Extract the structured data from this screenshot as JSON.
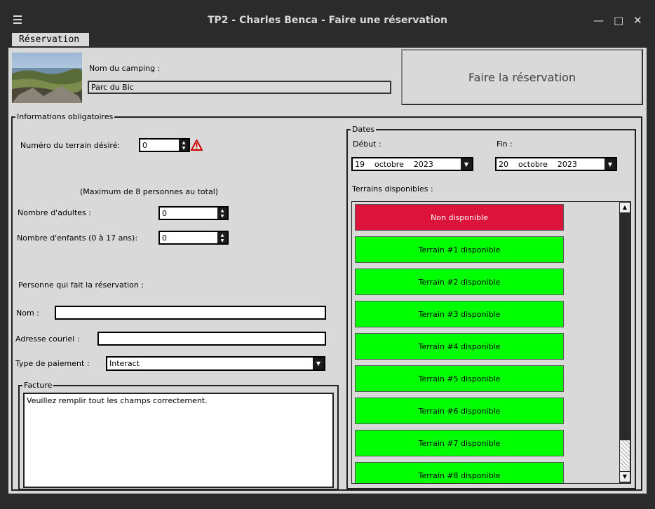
{
  "window": {
    "title": "TP2 - Charles Benca - Faire une réservation",
    "minimize": "—",
    "maximize": "□",
    "close": "✕"
  },
  "menu": {
    "reservation": "Réservation"
  },
  "camping": {
    "label": "Nom du camping :",
    "value": "Parc du Bic"
  },
  "submit_button": "Faire la réservation",
  "info": {
    "legend": "Informations obligatoires",
    "terrain_label": "Numéro du terrain désiré:",
    "terrain_value": "0",
    "max_note": "(Maximum de 8 personnes au total)",
    "adults_label": "Nombre d'adultes :",
    "adults_value": "0",
    "children_label": "Nombre d'enfants (0 à 17 ans):",
    "children_value": "0",
    "person_heading": "Personne qui fait la réservation :",
    "name_label": "Nom :",
    "name_value": "",
    "email_label": "Adresse couriel :",
    "email_value": "",
    "payment_label": "Type de paiement :",
    "payment_value": "Interact"
  },
  "invoice": {
    "legend": "Facture",
    "text": "Veuillez remplir tout les champs correctement."
  },
  "dates": {
    "legend": "Dates",
    "start_label": "Début :",
    "start": {
      "day": "19",
      "month": "octobre",
      "year": "2023"
    },
    "end_label": "Fin :",
    "end": {
      "day": "20",
      "month": "octobre",
      "year": "2023"
    },
    "available_label": "Terrains disponibles :"
  },
  "terrains": [
    {
      "label": "Non disponible",
      "status": "unavailable"
    },
    {
      "label": "Terrain #1 disponible",
      "status": "available"
    },
    {
      "label": "Terrain #2 disponible",
      "status": "available"
    },
    {
      "label": "Terrain #3 disponible",
      "status": "available"
    },
    {
      "label": "Terrain #4 disponible",
      "status": "available"
    },
    {
      "label": "Terrain #5 disponible",
      "status": "available"
    },
    {
      "label": "Terrain #6 disponible",
      "status": "available"
    },
    {
      "label": "Terrain #7 disponible",
      "status": "available"
    },
    {
      "label": "Terrain #8 disponible",
      "status": "available"
    }
  ],
  "colors": {
    "available": "#00ff00",
    "unavailable": "#dc143c",
    "warning": "#cc0000"
  }
}
